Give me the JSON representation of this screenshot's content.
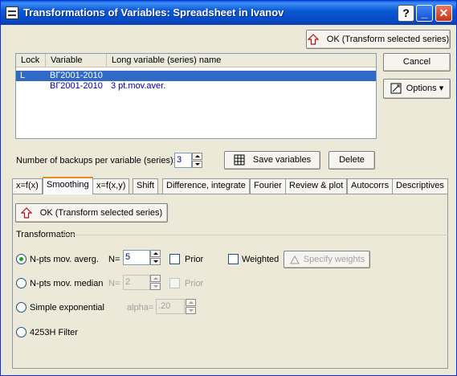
{
  "window": {
    "title": "Transformations of Variables: Spreadsheet in Ivanov",
    "help_label": "?",
    "min_label": "_",
    "close_label": "✕"
  },
  "actions": {
    "ok_top": "OK (Transform selected series)",
    "cancel": "Cancel",
    "options": "Options ▾"
  },
  "variables_list": {
    "columns": [
      "Lock",
      "Variable",
      "Long variable (series) name"
    ],
    "rows": [
      {
        "lock": "L",
        "variable": "ВГ2001-2010",
        "name": ""
      },
      {
        "lock": "",
        "variable": "ВГ2001-2010",
        "name": "3 pt.mov.aver."
      }
    ]
  },
  "backups": {
    "label": "Number of backups per variable (series):",
    "value": "3",
    "save_label": "Save variables",
    "delete_label": "Delete"
  },
  "tabs": [
    "x=f(x)",
    "Smoothing",
    "x=f(x,y)",
    "Shift",
    "Difference, integrate",
    "Fourier",
    "Review & plot",
    "Autocorrs",
    "Descriptives"
  ],
  "active_tab": "Smoothing",
  "panel": {
    "ok_label": "OK (Transform selected series)",
    "group_label": "Transformation",
    "option1": {
      "label": "N-pts mov. averg.",
      "n_label": "N=",
      "n_value": "5",
      "prior": "Prior",
      "weighted": "Weighted",
      "specify": "Specify weights"
    },
    "option2": {
      "label": "N-pts mov. median",
      "n_label": "N=",
      "n_value": "2",
      "prior": "Prior"
    },
    "option3": {
      "label": "Simple exponential",
      "alpha_label": "alpha=",
      "alpha_value": ".20"
    },
    "option4": {
      "label": "4253H Filter"
    }
  }
}
